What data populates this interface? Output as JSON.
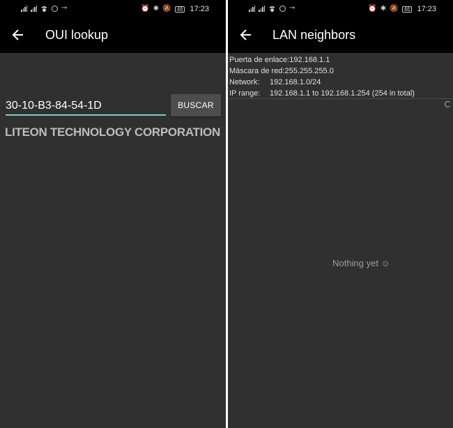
{
  "status_bar": {
    "time": "17:23",
    "battery": "46",
    "icons": [
      "signal-icon",
      "signal-icon",
      "wifi-icon",
      "sync-icon",
      "key-icon",
      "alarm-icon",
      "bluetooth-icon",
      "mute-icon",
      "battery-icon"
    ]
  },
  "oui_screen": {
    "title": "OUI lookup",
    "input_value": "30-10-B3-84-54-1D",
    "button_label": "BUSCAR",
    "result": "LITEON TECHNOLOGY CORPORATION"
  },
  "lan_screen": {
    "title": "LAN neighbors",
    "info": [
      {
        "label": "Puerta de enlace:",
        "value": "192.168.1.1"
      },
      {
        "label": "Máscara de red:",
        "value": "255.255.255.0"
      },
      {
        "label": "Network:",
        "value": "192.168.1.0/24"
      },
      {
        "label": "IP range:",
        "value": "192.168.1.1 to 192.168.1.254 (254 in total)"
      }
    ],
    "empty_text": "Nothing yet ☺"
  },
  "colors": {
    "accent": "#80cbc4",
    "background": "#303030",
    "appbar": "#000000"
  }
}
